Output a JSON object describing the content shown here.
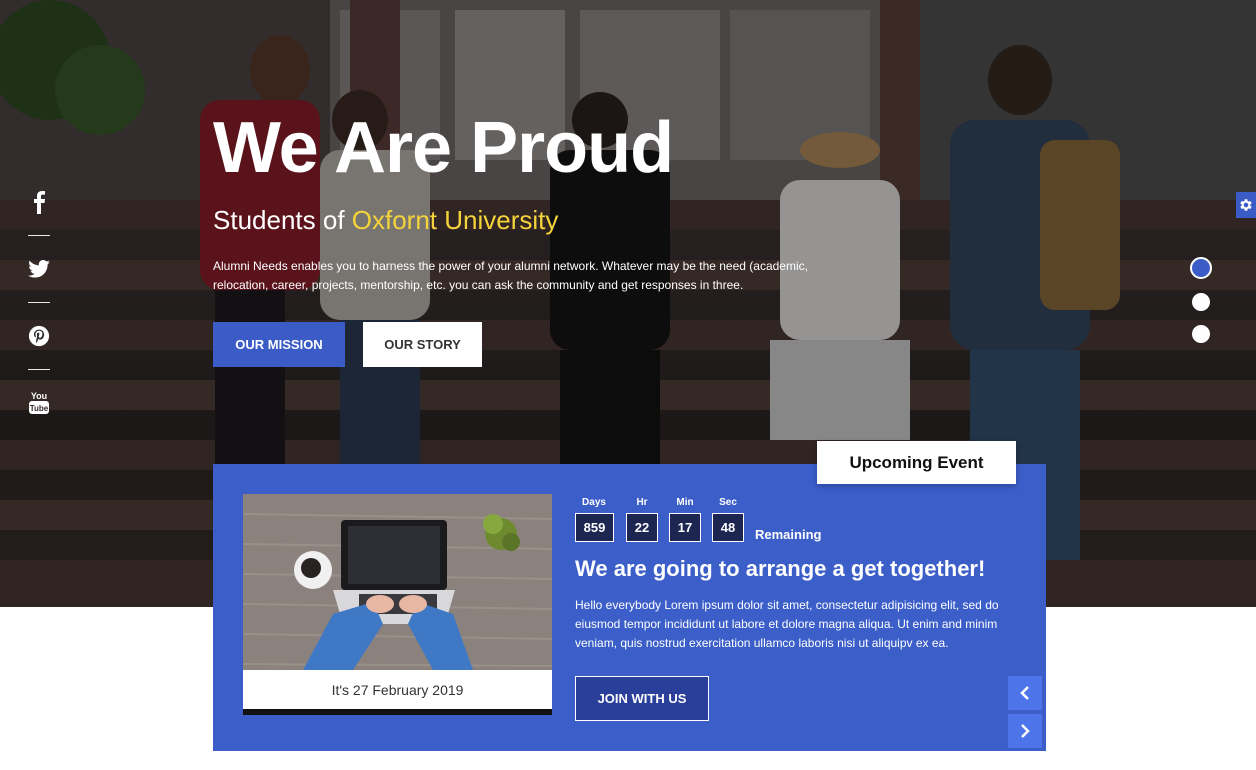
{
  "hero": {
    "title": "We Are Proud",
    "subtitle_prefix": "Students of ",
    "subtitle_accent": "Oxfornt University",
    "description": "Alumni Needs enables you to harness the power of your alumni network. Whatever may be the need (academic, relocation, career, projects, mentorship, etc. you can ask the community and get responses in three.",
    "mission_button": "OUR MISSION",
    "story_button": "OUR STORY"
  },
  "social": [
    "facebook-icon",
    "twitter-icon",
    "pinterest-icon",
    "youtube-icon"
  ],
  "slider": {
    "slides": 3,
    "active": 1
  },
  "event": {
    "tab_label": "Upcoming Event",
    "image_caption": "It's 27 February 2019",
    "countdown": [
      {
        "label": "Days",
        "value": "859"
      },
      {
        "label": "Hr",
        "value": "22"
      },
      {
        "label": "Min",
        "value": "17"
      },
      {
        "label": "Sec",
        "value": "48"
      }
    ],
    "remaining_label": "Remaining",
    "title": "We are going to arrange a get together!",
    "description": "Hello everybody Lorem ipsum dolor sit amet, consectetur adipisicing elit, sed do eiusmod tempor incididunt ut labore et dolore magna aliqua. Ut enim and minim veniam, quis nostrud exercitation ullamco laboris nisi ut aliquipv ex ea.",
    "join_button": "JOIN WITH US"
  },
  "colors": {
    "accent": "#3b5cc6",
    "highlight": "#f5d43b",
    "event_bg": "#3b5ec9"
  }
}
